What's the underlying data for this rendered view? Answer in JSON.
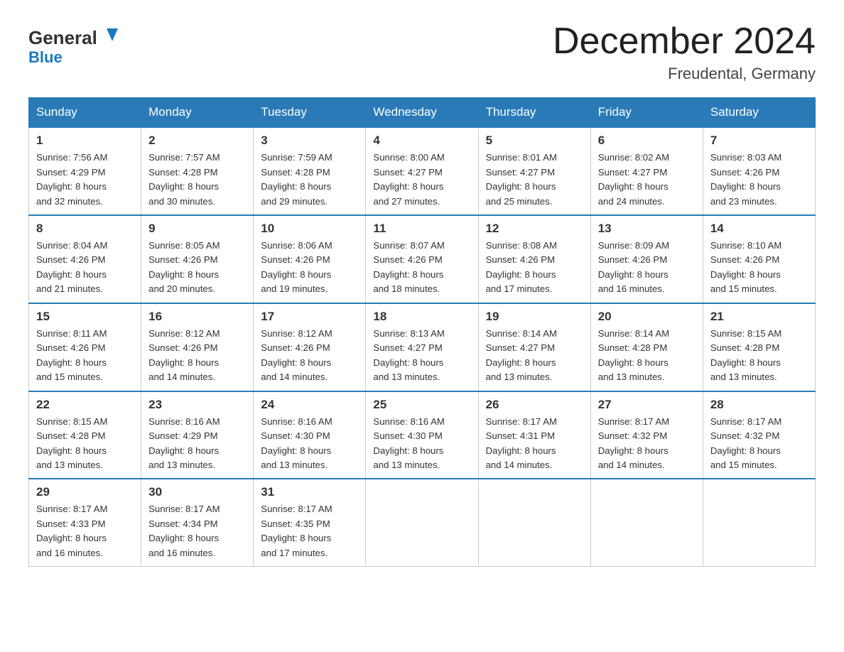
{
  "header": {
    "logo_general": "General",
    "logo_blue": "Blue",
    "month_year": "December 2024",
    "location": "Freudental, Germany"
  },
  "weekdays": [
    "Sunday",
    "Monday",
    "Tuesday",
    "Wednesday",
    "Thursday",
    "Friday",
    "Saturday"
  ],
  "weeks": [
    [
      {
        "day": "1",
        "sunrise": "7:56 AM",
        "sunset": "4:29 PM",
        "daylight": "8 hours and 32 minutes."
      },
      {
        "day": "2",
        "sunrise": "7:57 AM",
        "sunset": "4:28 PM",
        "daylight": "8 hours and 30 minutes."
      },
      {
        "day": "3",
        "sunrise": "7:59 AM",
        "sunset": "4:28 PM",
        "daylight": "8 hours and 29 minutes."
      },
      {
        "day": "4",
        "sunrise": "8:00 AM",
        "sunset": "4:27 PM",
        "daylight": "8 hours and 27 minutes."
      },
      {
        "day": "5",
        "sunrise": "8:01 AM",
        "sunset": "4:27 PM",
        "daylight": "8 hours and 25 minutes."
      },
      {
        "day": "6",
        "sunrise": "8:02 AM",
        "sunset": "4:27 PM",
        "daylight": "8 hours and 24 minutes."
      },
      {
        "day": "7",
        "sunrise": "8:03 AM",
        "sunset": "4:26 PM",
        "daylight": "8 hours and 23 minutes."
      }
    ],
    [
      {
        "day": "8",
        "sunrise": "8:04 AM",
        "sunset": "4:26 PM",
        "daylight": "8 hours and 21 minutes."
      },
      {
        "day": "9",
        "sunrise": "8:05 AM",
        "sunset": "4:26 PM",
        "daylight": "8 hours and 20 minutes."
      },
      {
        "day": "10",
        "sunrise": "8:06 AM",
        "sunset": "4:26 PM",
        "daylight": "8 hours and 19 minutes."
      },
      {
        "day": "11",
        "sunrise": "8:07 AM",
        "sunset": "4:26 PM",
        "daylight": "8 hours and 18 minutes."
      },
      {
        "day": "12",
        "sunrise": "8:08 AM",
        "sunset": "4:26 PM",
        "daylight": "8 hours and 17 minutes."
      },
      {
        "day": "13",
        "sunrise": "8:09 AM",
        "sunset": "4:26 PM",
        "daylight": "8 hours and 16 minutes."
      },
      {
        "day": "14",
        "sunrise": "8:10 AM",
        "sunset": "4:26 PM",
        "daylight": "8 hours and 15 minutes."
      }
    ],
    [
      {
        "day": "15",
        "sunrise": "8:11 AM",
        "sunset": "4:26 PM",
        "daylight": "8 hours and 15 minutes."
      },
      {
        "day": "16",
        "sunrise": "8:12 AM",
        "sunset": "4:26 PM",
        "daylight": "8 hours and 14 minutes."
      },
      {
        "day": "17",
        "sunrise": "8:12 AM",
        "sunset": "4:26 PM",
        "daylight": "8 hours and 14 minutes."
      },
      {
        "day": "18",
        "sunrise": "8:13 AM",
        "sunset": "4:27 PM",
        "daylight": "8 hours and 13 minutes."
      },
      {
        "day": "19",
        "sunrise": "8:14 AM",
        "sunset": "4:27 PM",
        "daylight": "8 hours and 13 minutes."
      },
      {
        "day": "20",
        "sunrise": "8:14 AM",
        "sunset": "4:28 PM",
        "daylight": "8 hours and 13 minutes."
      },
      {
        "day": "21",
        "sunrise": "8:15 AM",
        "sunset": "4:28 PM",
        "daylight": "8 hours and 13 minutes."
      }
    ],
    [
      {
        "day": "22",
        "sunrise": "8:15 AM",
        "sunset": "4:28 PM",
        "daylight": "8 hours and 13 minutes."
      },
      {
        "day": "23",
        "sunrise": "8:16 AM",
        "sunset": "4:29 PM",
        "daylight": "8 hours and 13 minutes."
      },
      {
        "day": "24",
        "sunrise": "8:16 AM",
        "sunset": "4:30 PM",
        "daylight": "8 hours and 13 minutes."
      },
      {
        "day": "25",
        "sunrise": "8:16 AM",
        "sunset": "4:30 PM",
        "daylight": "8 hours and 13 minutes."
      },
      {
        "day": "26",
        "sunrise": "8:17 AM",
        "sunset": "4:31 PM",
        "daylight": "8 hours and 14 minutes."
      },
      {
        "day": "27",
        "sunrise": "8:17 AM",
        "sunset": "4:32 PM",
        "daylight": "8 hours and 14 minutes."
      },
      {
        "day": "28",
        "sunrise": "8:17 AM",
        "sunset": "4:32 PM",
        "daylight": "8 hours and 15 minutes."
      }
    ],
    [
      {
        "day": "29",
        "sunrise": "8:17 AM",
        "sunset": "4:33 PM",
        "daylight": "8 hours and 16 minutes."
      },
      {
        "day": "30",
        "sunrise": "8:17 AM",
        "sunset": "4:34 PM",
        "daylight": "8 hours and 16 minutes."
      },
      {
        "day": "31",
        "sunrise": "8:17 AM",
        "sunset": "4:35 PM",
        "daylight": "8 hours and 17 minutes."
      },
      null,
      null,
      null,
      null
    ]
  ],
  "labels": {
    "sunrise": "Sunrise: ",
    "sunset": "Sunset: ",
    "daylight": "Daylight: "
  }
}
